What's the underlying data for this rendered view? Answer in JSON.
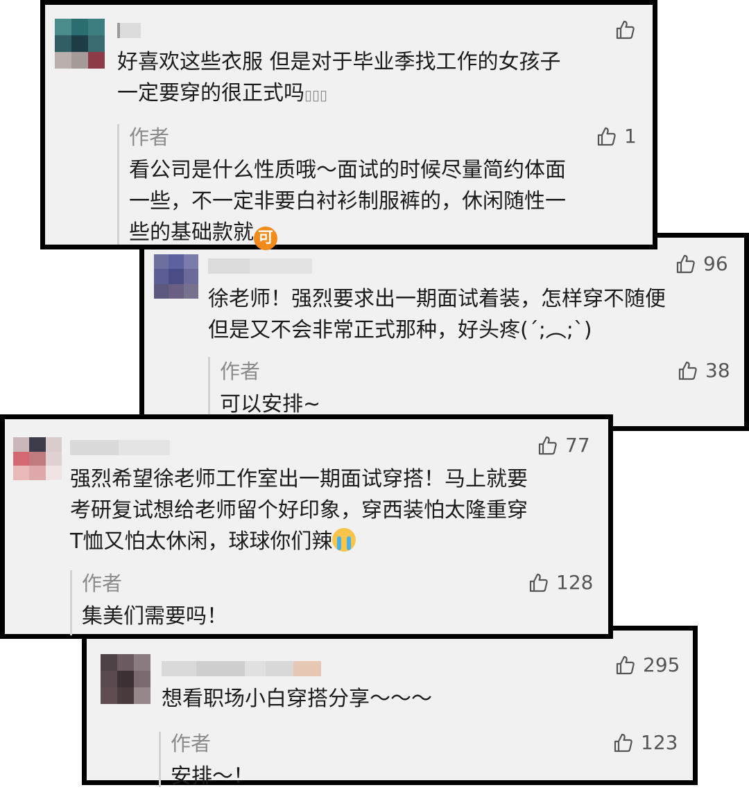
{
  "comments": [
    {
      "text_lines": [
        "好喜欢这些衣服 但是对于毕业季找工作的女孩子",
        "一定要穿的很正式吗"
      ],
      "trail": "▯▯▯",
      "likes": "",
      "reply": {
        "author": "作者",
        "likes": "1",
        "text_lines": [
          "看公司是什么性质哦～面试的时候尽量简约体面",
          "一些，不一定非要白衬衫制服裤的，休闲随性一",
          "些的基础款就"
        ],
        "emoji": "可"
      }
    },
    {
      "text_lines": [
        "徐老师！强烈要求出一期面试着装，怎样穿不随便",
        "但是又不会非常正式那种，好头疼(´;︵;`)"
      ],
      "likes": "96",
      "reply": {
        "author": "作者",
        "likes": "38",
        "text_lines": [
          "可以安排~"
        ]
      }
    },
    {
      "text_lines": [
        "强烈希望徐老师工作室出一期面试穿搭！马上就要",
        "考研复试想给老师留个好印象，穿西装怕太隆重穿",
        "T恤又怕太休闲，球球你们辣"
      ],
      "likes": "77",
      "reply": {
        "author": "作者",
        "likes": "128",
        "text_lines": [
          "集美们需要吗！"
        ]
      }
    },
    {
      "text_lines": [
        "想看职场小白穿搭分享～～～"
      ],
      "likes": "295",
      "reply": {
        "author": "作者",
        "likes": "123",
        "text_lines": [
          "安排～！"
        ]
      }
    }
  ],
  "icons": {
    "like": "thumbs-up-icon",
    "emoji_1": "ke-emoji-icon",
    "emoji_2": "crying-emoji-icon"
  },
  "colors": {
    "card_bg": "#f1f1f1",
    "border": "#000000",
    "author_gray": "#8a8a8a",
    "text": "#1b1b1b"
  }
}
